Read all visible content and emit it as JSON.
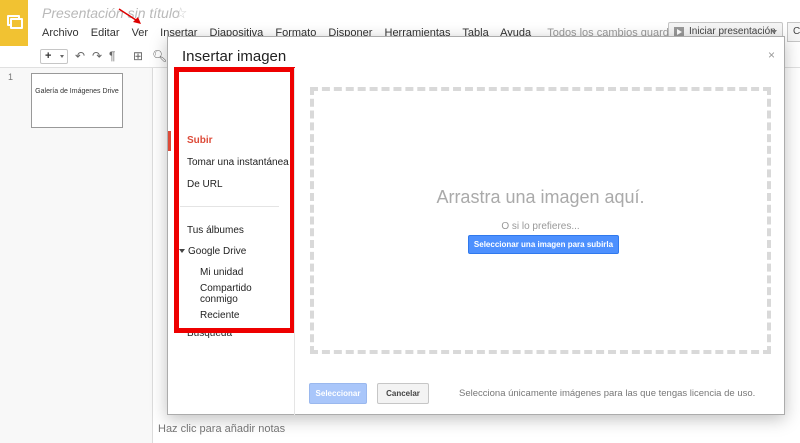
{
  "app": {
    "title": "Presentación sin título",
    "menu": [
      "Archivo",
      "Editar",
      "Ver",
      "Insertar",
      "Diapositiva",
      "Formato",
      "Disponer",
      "Herramientas",
      "Tabla",
      "Ayuda"
    ],
    "saved_status": "Todos los cambios guardados en Drive",
    "present_label": "Iniciar presentación",
    "share_label": "C",
    "toolbar_add": "+",
    "slide_number": "1",
    "slide_thumb_text": "Galería de Imágenes Drive",
    "notes_placeholder": "Haz clic para añadir notas"
  },
  "dialog": {
    "title": "Insertar imagen",
    "close_glyph": "×",
    "sidebar": {
      "upload": "Subir",
      "snapshot": "Tomar una instantánea",
      "url": "De URL",
      "albums": "Tus álbumes",
      "drive": "Google Drive",
      "my_drive": "Mi unidad",
      "shared": "Compartido conmigo",
      "recent": "Reciente",
      "search": "Búsqueda"
    },
    "drop_title": "Arrastra una imagen aquí.",
    "drop_or": "O si lo prefieres...",
    "upload_button": "Seleccionar una imagen para subirla",
    "select_button": "Seleccionar",
    "cancel_button": "Cancelar",
    "license_note": "Selecciona únicamente imágenes para las que tengas licencia de uso."
  },
  "colors": {
    "accent_red": "#dd4b39",
    "highlight_red": "#ee0000",
    "primary_blue": "#4d90fe",
    "logo_yellow": "#f1c232"
  }
}
